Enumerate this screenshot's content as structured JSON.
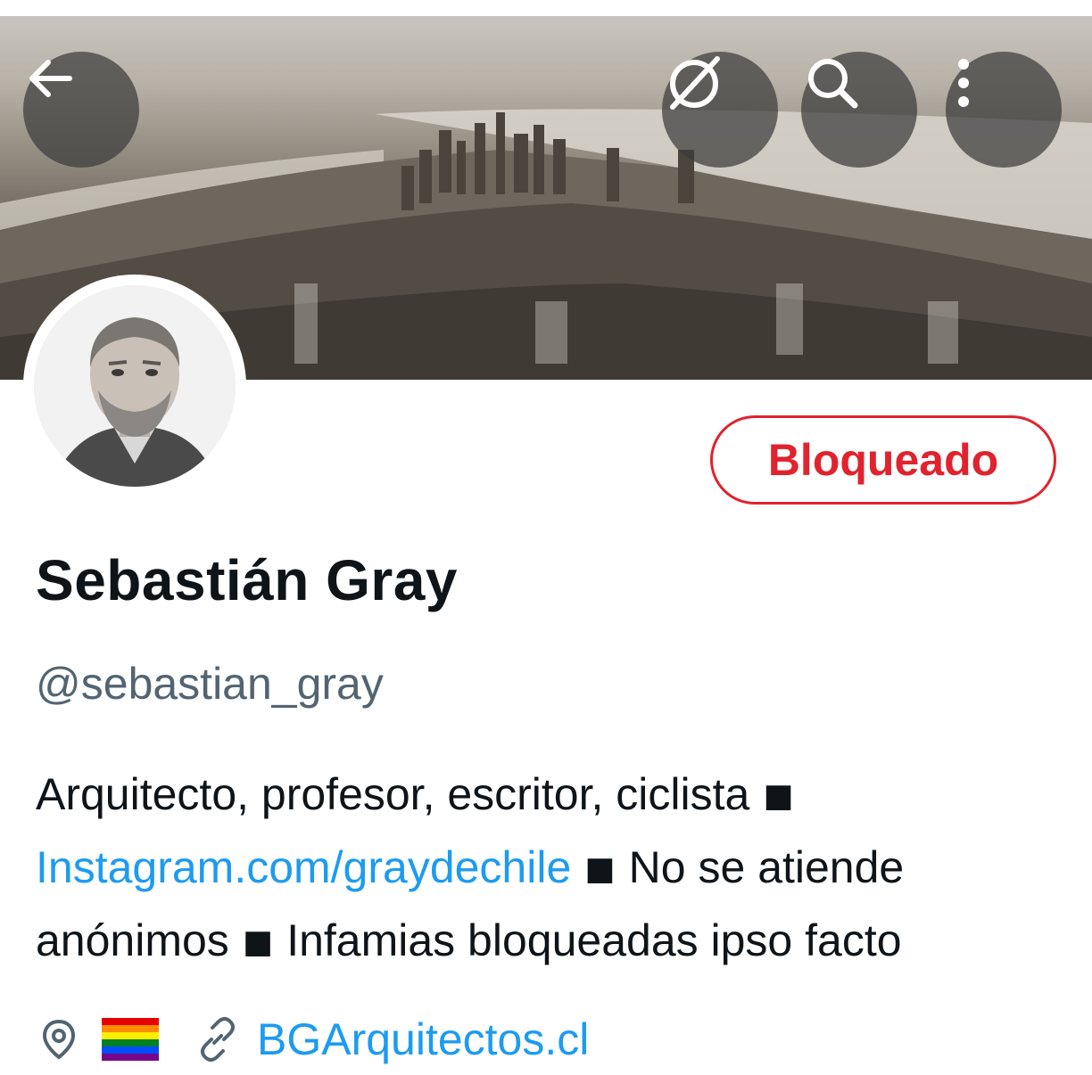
{
  "header": {
    "back_icon": "back-arrow-icon",
    "grok_icon": "slash-circle-icon",
    "search_icon": "search-icon",
    "more_icon": "more-vertical-icon"
  },
  "profile": {
    "name": "Sebastián Gray",
    "handle": "@sebastian_gray",
    "block_button_label": "Bloqueado",
    "bio": {
      "line1": "Arquitecto, profesor, escritor, ciclista ◾",
      "link": "Instagram.com/graydechile",
      "line2_rest": " ◾ No se atiende",
      "line3": "anónimos ◾ Infamias bloqueadas ipso facto"
    },
    "location_flag": "🏳️‍🌈",
    "website": "BGArquitectos.cl"
  },
  "colors": {
    "accent_red": "#e0232e",
    "link_blue": "#1d9bf0",
    "text_primary": "#0f1419",
    "text_secondary": "#536471"
  }
}
